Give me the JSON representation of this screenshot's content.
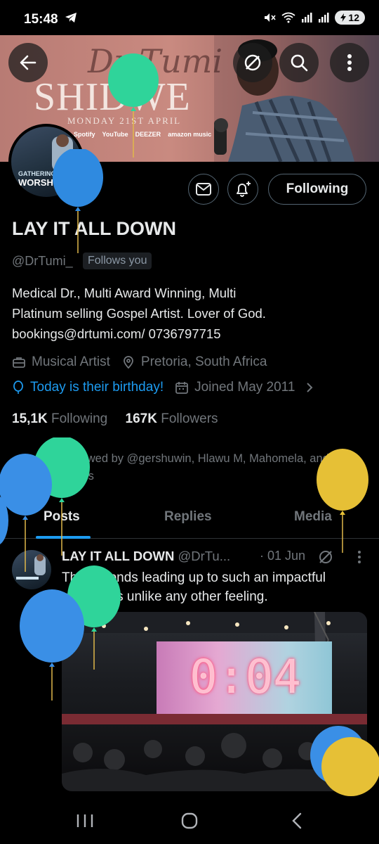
{
  "status_bar": {
    "time": "15:48",
    "battery": "12"
  },
  "banner": {
    "script_title": "Dr Tumi",
    "title": "SHIDWE",
    "date_line": "MONDAY 21ST APRIL",
    "platforms": [
      "Spotify",
      "YouTube",
      "DEEZER",
      "amazon music"
    ]
  },
  "header_actions": {
    "back": "back",
    "grok": "grok",
    "search": "search",
    "more": "more"
  },
  "avatar_text": {
    "line1": "GATHERING",
    "line2": "WORSHIPERS"
  },
  "profile": {
    "display_name": "LAY IT ALL DOWN",
    "handle": "@DrTumi_",
    "follows_you": "Follows you",
    "bio_line1": "Medical Dr., Multi Award Winning, Multi",
    "bio_line2": "Platinum selling Gospel Artist. Lover of God.",
    "bio_line3": "bookings@drtumi.com/ 0736797715",
    "category": "Musical Artist",
    "location": "Pretoria, South Africa",
    "birthday": "Today is their birthday!",
    "joined": "Joined May 2011",
    "following_count": "15,1K",
    "following_label": "Following",
    "followers_count": "167K",
    "followers_label": "Followers",
    "followed_by": "Followed by @gershuwin, Hlawu M, Mahomela, and 307 others"
  },
  "buttons": {
    "following": "Following"
  },
  "tabs": [
    "Posts",
    "Replies",
    "Media"
  ],
  "post": {
    "author": "LAY IT ALL DOWN",
    "handle": "@DrTu...",
    "date": "· 01 Jun",
    "text": "The seconds leading up to such an impactful moment is unlike any other feeling.",
    "video_countdown": "0:04"
  },
  "colors": {
    "accent": "#1d9bf0",
    "background": "#000000",
    "muted": "#71767b"
  }
}
